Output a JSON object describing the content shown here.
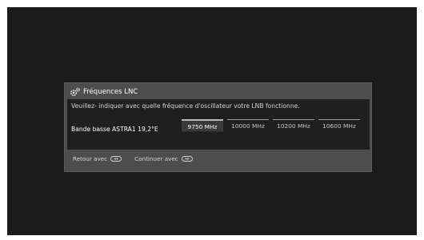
{
  "dialog": {
    "title": "Fréquences LNC",
    "instruction": "Veuillez- indiquer avec quelle fréquence d'oscillateur votre LNB fonctionne.",
    "band_label": "Bande basse ASTRA1 19,2°E",
    "options": [
      {
        "label": "9750 MHz",
        "selected": true
      },
      {
        "label": "10000 MHz",
        "selected": false
      },
      {
        "label": "10200 MHz",
        "selected": false
      },
      {
        "label": "10600 MHz",
        "selected": false
      }
    ],
    "footer": {
      "back_label": "Retour avec",
      "back_icon": "rewind-key-icon",
      "continue_label": "Continuer avec",
      "continue_icon": "fast-forward-key-icon"
    }
  },
  "colors": {
    "screen_background": "#1b1b1b",
    "dialog_background": "#4d4d4d",
    "body_background": "#1f1f1f",
    "text": "#ffffff"
  }
}
